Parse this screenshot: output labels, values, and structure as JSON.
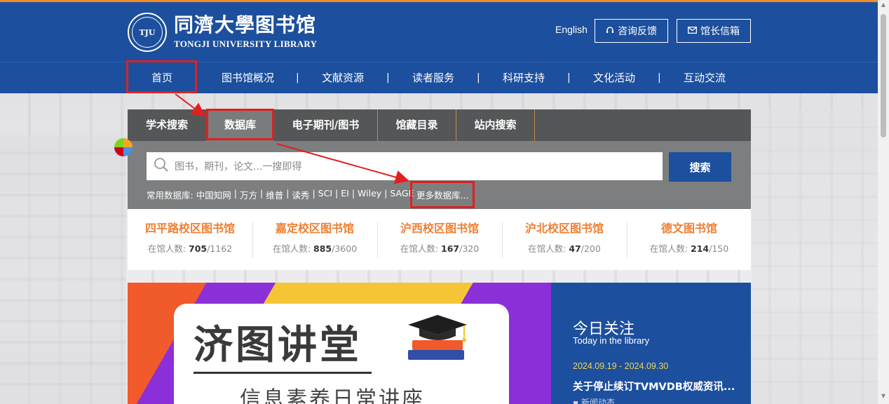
{
  "header": {
    "logo_cn": "同濟大學图书馆",
    "logo_en": "TONGJI UNIVERSITY LIBRARY",
    "seal_text": "TJU",
    "lang_link": "English",
    "consult_button": "咨询反馈",
    "mailbox_button": "馆长信箱"
  },
  "nav": {
    "items": [
      "首页",
      "图书馆概况",
      "文献资源",
      "读者服务",
      "科研支持",
      "文化活动",
      "互动交流"
    ],
    "separator": "|"
  },
  "search": {
    "tabs": [
      "学术搜索",
      "数据库",
      "电子期刊/图书",
      "馆藏目录",
      "站内搜索"
    ],
    "active_tab": "数据库",
    "placeholder": "图书，期刊，论文...一搜即得",
    "button": "搜索",
    "common_db_label": "常用数据库:",
    "databases": [
      "中国知网",
      "万方",
      "维普",
      "读秀",
      "SCI",
      "EI",
      "Wiley",
      "SAGE"
    ],
    "more_link": "更多数据库..."
  },
  "campuses": [
    {
      "name": "四平路校区图书馆",
      "label": "在馆人数:",
      "current": "705",
      "capacity": "/1162"
    },
    {
      "name": "嘉定校区图书馆",
      "label": "在馆人数:",
      "current": "885",
      "capacity": "/3600"
    },
    {
      "name": "沪西校区图书馆",
      "label": "在馆人数:",
      "current": "167",
      "capacity": "/320"
    },
    {
      "name": "沪北校区图书馆",
      "label": "在馆人数:",
      "current": "47",
      "capacity": "/200"
    },
    {
      "name": "德文图书馆",
      "label": "在馆人数:",
      "current": "214",
      "capacity": "/150"
    }
  ],
  "banner": {
    "title": "济图讲堂",
    "subtitle": "信息素养日常讲座"
  },
  "today": {
    "title": "今日关注",
    "title_en": "Today in the library",
    "date": "2024.09.19 - 2024.09.30",
    "headline": "关于停止续订TVMVDB权威资讯...",
    "tag": "新闻动态"
  },
  "colors": {
    "primary_blue": "#1c4f9d",
    "accent_orange": "#f07f32",
    "annotation_red": "#e02020",
    "date_yellow": "#f5d64a"
  },
  "icons": {
    "search": "search-icon",
    "consult": "headset-icon",
    "mail": "mail-icon"
  }
}
